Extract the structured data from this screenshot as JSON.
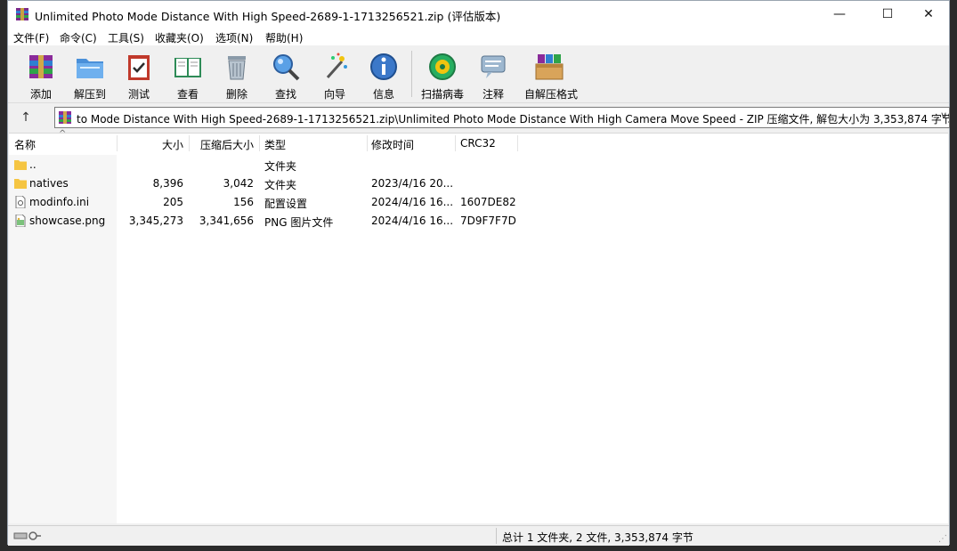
{
  "window": {
    "title": "Unlimited Photo Mode Distance With High Speed-2689-1-1713256521.zip (评估版本)",
    "minimize_glyph": "—",
    "maximize_glyph": "☐",
    "close_glyph": "✕"
  },
  "menu": {
    "items": [
      {
        "label": "文件(F)"
      },
      {
        "label": "命令(C)"
      },
      {
        "label": "工具(S)"
      },
      {
        "label": "收藏夹(O)"
      },
      {
        "label": "选项(N)"
      },
      {
        "label": "帮助(H)"
      }
    ]
  },
  "toolbar": {
    "buttons": [
      {
        "label": "添加",
        "icon": "archive-add-icon"
      },
      {
        "label": "解压到",
        "icon": "folder-extract-icon"
      },
      {
        "label": "测试",
        "icon": "test-clipboard-icon"
      },
      {
        "label": "查看",
        "icon": "view-book-icon"
      },
      {
        "label": "删除",
        "icon": "trash-icon"
      },
      {
        "label": "查找",
        "icon": "magnifier-icon"
      },
      {
        "label": "向导",
        "icon": "wizard-wand-icon"
      },
      {
        "label": "信息",
        "icon": "info-icon"
      },
      {
        "label": "扫描病毒",
        "icon": "virus-scan-icon"
      },
      {
        "label": "注释",
        "icon": "comment-icon"
      },
      {
        "label": "自解压格式",
        "icon": "sfx-box-icon"
      }
    ]
  },
  "address": {
    "up_glyph": "↑",
    "path": "to Mode Distance With High Speed-2689-1-1713256521.zip\\Unlimited Photo Mode Distance With High Camera Move Speed - ZIP 压缩文件, 解包大小为 3,353,874 字节",
    "dropdown_glyph": "∨"
  },
  "list": {
    "columns": {
      "name": "名称",
      "size": "大小",
      "packed": "压缩后大小",
      "type": "类型",
      "modified": "修改时间",
      "crc": "CRC32"
    },
    "sort_glyph": "^",
    "rows": [
      {
        "name": "..",
        "size": "",
        "packed": "",
        "type": "文件夹",
        "modified": "",
        "crc": "",
        "icon": "folder-icon"
      },
      {
        "name": "natives",
        "size": "8,396",
        "packed": "3,042",
        "type": "文件夹",
        "modified": "2023/4/16 20...",
        "crc": "",
        "icon": "folder-icon"
      },
      {
        "name": "modinfo.ini",
        "size": "205",
        "packed": "156",
        "type": "配置设置",
        "modified": "2024/4/16 16...",
        "crc": "1607DE82",
        "icon": "ini-file-icon"
      },
      {
        "name": "showcase.png",
        "size": "3,345,273",
        "packed": "3,341,656",
        "type": "PNG 图片文件",
        "modified": "2024/4/16 16...",
        "crc": "7D9F7F7D",
        "icon": "image-file-icon"
      }
    ]
  },
  "status": {
    "summary": "总计 1 文件夹, 2 文件, 3,353,874 字节"
  },
  "colors": {
    "window_bg": "#f0f0f0",
    "list_bg": "#ffffff",
    "folder": "#f5c542",
    "desktop": "#2b2b2b"
  }
}
